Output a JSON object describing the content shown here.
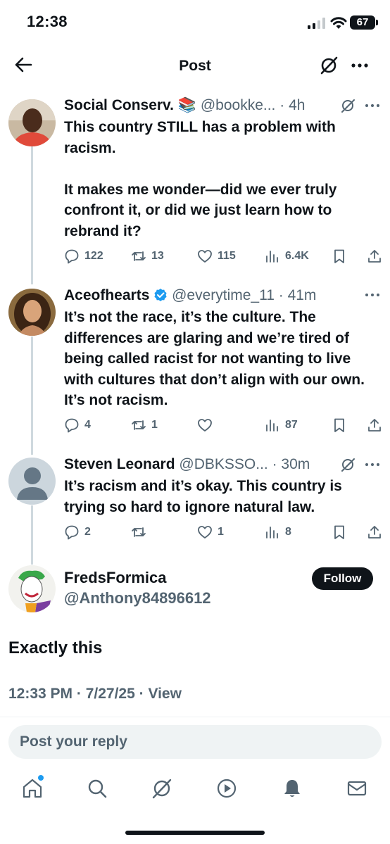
{
  "status_bar": {
    "time": "12:38",
    "battery": "67"
  },
  "header": {
    "title": "Post"
  },
  "tweets": [
    {
      "name": "Social Conserv. 📚",
      "handle": "@bookke...",
      "time": "4h",
      "text": "This country STILL has a problem with racism.\n\nIt makes me wonder—did we ever truly confront it, or did we just learn how to rebrand it?",
      "replies": "122",
      "retweets": "13",
      "likes": "115",
      "views": "6.4K"
    },
    {
      "name": "Aceofhearts",
      "handle": "@everytime_11",
      "time": "41m",
      "verified": true,
      "text": "It’s not the race, it’s the culture. The differences are glaring and we’re tired of being called racist for not wanting to live with cultures that don’t align with our own. It’s not racism.",
      "replies": "4",
      "retweets": "1",
      "likes": "",
      "views": "87"
    },
    {
      "name": "Steven Leonard",
      "handle": "@DBKSSO...",
      "time": "30m",
      "text": "It’s racism and it’s okay. This country is trying so hard to ignore natural law.",
      "replies": "2",
      "retweets": "",
      "likes": "1",
      "views": "8"
    }
  ],
  "main_post": {
    "name": "FredsFormica",
    "handle": "@Anthony84896612",
    "follow_label": "Follow",
    "text": "Exactly this",
    "time": "12:33 PM",
    "date": "7/27/25",
    "view_label": "View"
  },
  "reply": {
    "placeholder": "Post your reply"
  },
  "icons": {
    "back": "arrow-left-icon",
    "grok": "grok-icon",
    "more": "more-horizontal-icon",
    "reply": "reply-bubble-icon",
    "retweet": "retweet-icon",
    "like": "heart-icon",
    "views": "views-bar-icon",
    "bookmark": "bookmark-icon",
    "share": "share-icon",
    "verified": "verified-badge-icon",
    "tabs": [
      "home-icon",
      "search-icon",
      "grok-icon",
      "play-icon",
      "bell-icon",
      "mail-icon"
    ]
  },
  "colors": {
    "text": "#0f1419",
    "secondary": "#536471",
    "accent": "#1d9bf0",
    "thread_line": "#cfd9de",
    "input_bg": "#eff3f4"
  }
}
